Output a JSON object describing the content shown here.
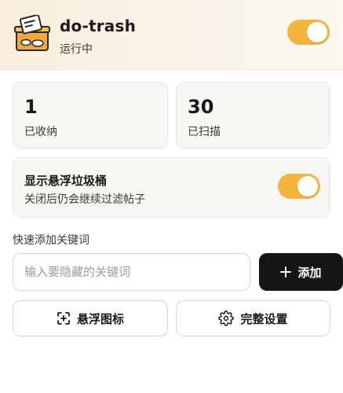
{
  "header": {
    "app_name": "do-trash",
    "status": "运行中",
    "logo_icon": "trash-box-icon",
    "enabled": true
  },
  "stats": [
    {
      "value": "1",
      "label": "已收纳"
    },
    {
      "value": "30",
      "label": "已扫描"
    }
  ],
  "floating_bin": {
    "title": "显示悬浮垃圾桶",
    "description": "关闭后仍会继续过滤帖子",
    "enabled": true
  },
  "keyword": {
    "section_label": "快速添加关键词",
    "input_value": "",
    "placeholder": "输入要隐藏的关键词",
    "add_label": "添加",
    "add_icon": "plus-icon"
  },
  "actions": {
    "float_icon_label": "悬浮图标",
    "float_icon_icon": "focus-plus-icon",
    "settings_label": "完整设置",
    "settings_icon": "gear-icon"
  },
  "colors": {
    "accent": "#f5b43c",
    "primary_button": "#151515"
  }
}
